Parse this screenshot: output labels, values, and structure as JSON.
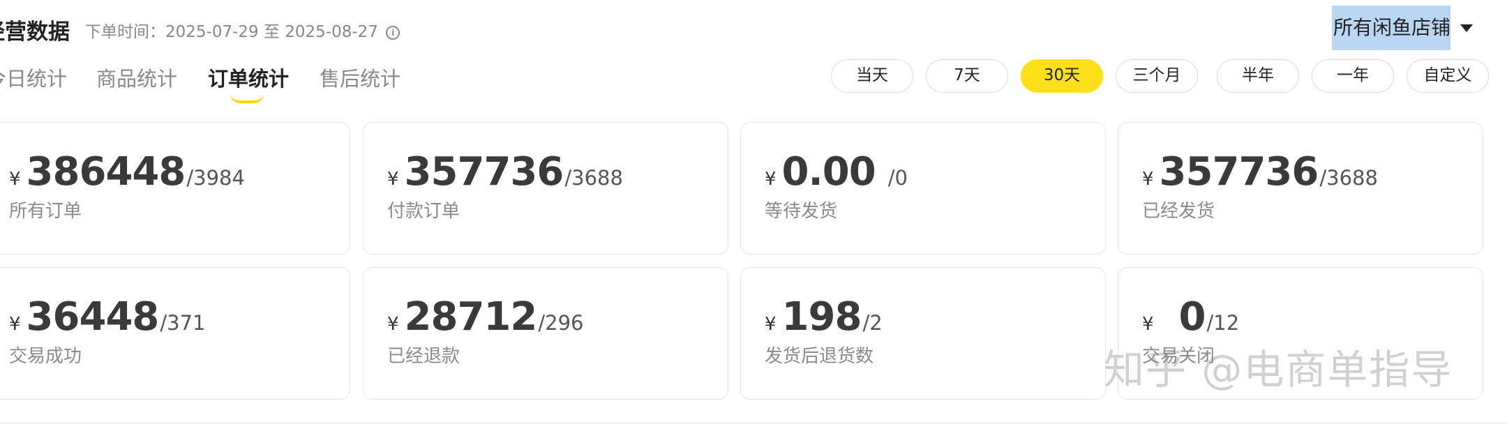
{
  "header": {
    "title": "经营数据",
    "order_time_label": "下单时间：2025-07-29 至 2025-08-27",
    "info_icon": "info-icon",
    "store_select": "所有闲鱼店铺",
    "store_caret_icon": "caret-down-icon"
  },
  "tabs": [
    {
      "label": "今日统计",
      "active": false
    },
    {
      "label": "商品统计",
      "active": false
    },
    {
      "label": "订单统计",
      "active": true
    },
    {
      "label": "售后统计",
      "active": false
    }
  ],
  "ranges": [
    {
      "label": "当天",
      "active": false
    },
    {
      "label": "7天",
      "active": false
    },
    {
      "label": "30天",
      "active": true
    },
    {
      "label": "三个月",
      "active": false
    },
    {
      "label": "半年",
      "active": false
    },
    {
      "label": "一年",
      "active": false
    },
    {
      "label": "自定义",
      "active": false
    }
  ],
  "currency_symbol": "¥",
  "cards": [
    {
      "amount": "386448",
      "count": "/3984",
      "label": "所有订单"
    },
    {
      "amount": "357736",
      "count": "/3688",
      "label": "付款订单"
    },
    {
      "amount": "0.00",
      "count": "/0",
      "label": "等待发货"
    },
    {
      "amount": "357736",
      "count": "/3688",
      "label": "已经发货"
    },
    {
      "amount": "36448",
      "count": "/371",
      "label": "交易成功"
    },
    {
      "amount": "28712",
      "count": "/296",
      "label": "已经退款"
    },
    {
      "amount": "198",
      "count": "/2",
      "label": "发货后退货数"
    },
    {
      "amount": "0",
      "count": "/12",
      "label": "交易关闭"
    }
  ],
  "watermark": "知乎 @电商单指导",
  "colors": {
    "accent": "#ffe01b",
    "selection": "#b9d6f5"
  }
}
